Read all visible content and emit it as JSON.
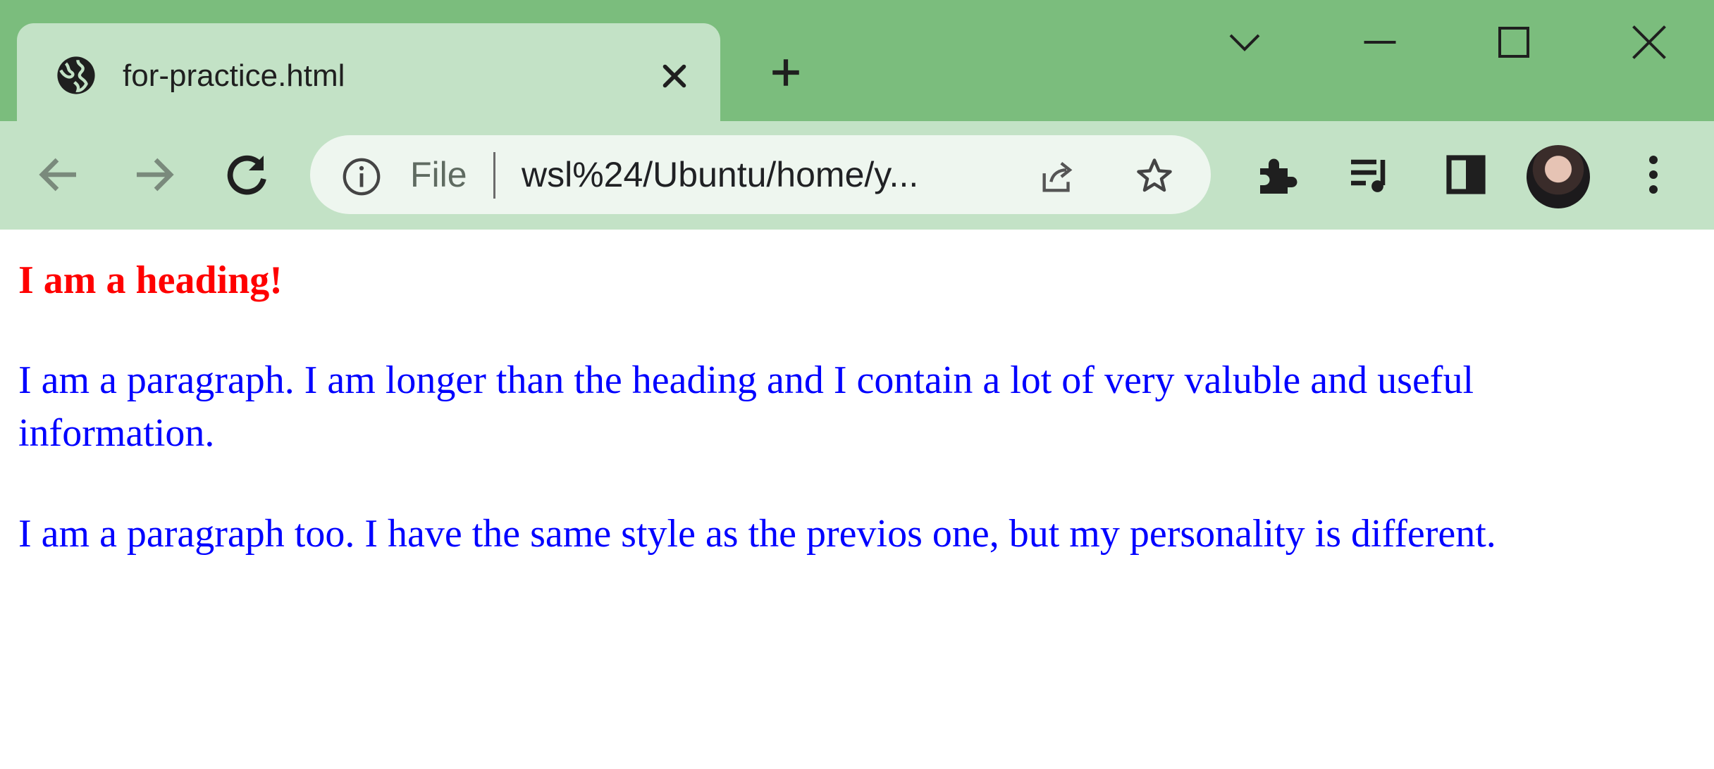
{
  "browser": {
    "tab": {
      "title": "for-practice.html",
      "icon": "globe-icon"
    },
    "address_bar": {
      "scheme_label": "File",
      "url_display": "wsl%24/Ubuntu/home/y..."
    },
    "colors": {
      "frame": "#7bbd7d",
      "toolbar": "#c3e2c6",
      "omnibox": "#eef6ef"
    }
  },
  "page": {
    "heading": "I am a heading!",
    "paragraphs": [
      "I am a paragraph. I am longer than the heading and I contain a lot of very valuble and useful information.",
      "I am a paragraph too. I have the same style as the previos one, but my personality is different."
    ],
    "colors": {
      "heading": "#ff0000",
      "paragraph": "#0000ff"
    }
  }
}
